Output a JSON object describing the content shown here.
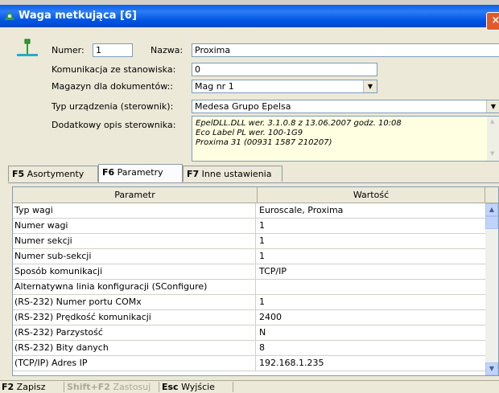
{
  "window": {
    "title": "Waga metkująca [6]",
    "close_glyph": "×"
  },
  "form": {
    "numer_label": "Numer:",
    "numer_value": "1",
    "nazwa_label": "Nazwa:",
    "nazwa_value": "Proxima",
    "komunikacja_label": "Komunikacja ze stanowiska:",
    "komunikacja_value": "0",
    "magazyn_label": "Magazyn dla dokumentów::",
    "magazyn_value": "Mag nr 1",
    "typ_label": "Typ urządzenia (sterownik):",
    "typ_value": "Medesa Grupo Epelsa",
    "opis_label": "Dodatkowy opis sterownika:",
    "opis_lines": [
      "EpelDLL.DLL wer. 3.1.0.8 z 13.06.2007 godz. 10:08",
      "Eco Label PL wer. 100-1G9",
      "Proxima 31 (00931 1587 210207)"
    ]
  },
  "tabs": [
    {
      "key": "F5",
      "label": "Asortymenty"
    },
    {
      "key": "F6",
      "label": "Parametry"
    },
    {
      "key": "F7",
      "label": "Inne ustawienia"
    }
  ],
  "grid": {
    "headers": [
      "Parametr",
      "Wartość"
    ],
    "rows": [
      {
        "param": "Typ wagi",
        "value": "Euroscale, Proxima"
      },
      {
        "param": "Numer wagi",
        "value": "1"
      },
      {
        "param": "Numer sekcji",
        "value": "1"
      },
      {
        "param": "Numer sub-sekcji",
        "value": "1"
      },
      {
        "param": "Sposób komunikacji",
        "value": "TCP/IP"
      },
      {
        "param": "Alternatywna linia konfiguracji (SConfigure)",
        "value": ""
      },
      {
        "param": "(RS-232) Numer portu COMx",
        "value": "1"
      },
      {
        "param": "(RS-232) Prędkość komunikacji",
        "value": "2400"
      },
      {
        "param": "(RS-232) Parzystość",
        "value": "N"
      },
      {
        "param": "(RS-232) Bity danych",
        "value": "8"
      },
      {
        "param": "(TCP/IP) Adres IP",
        "value": "192.168.1.235"
      }
    ]
  },
  "statusbar": [
    {
      "key": "F2",
      "label": "Zapisz",
      "enabled": true
    },
    {
      "key": "Shift+F2",
      "label": "Zastosuj",
      "enabled": false
    },
    {
      "key": "Esc",
      "label": "Wyjście",
      "enabled": true
    }
  ],
  "icons": {
    "dropdown_arrow": "▼",
    "scroll_up": "▲",
    "scroll_down": "▼"
  },
  "colors": {
    "titlebar": "#0054e3",
    "memo_bg": "#ffffe1",
    "scale_icon": "#2fa02f"
  }
}
